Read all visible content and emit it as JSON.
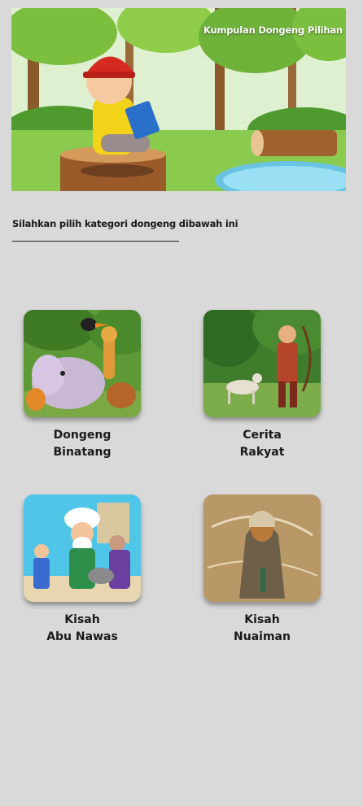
{
  "hero": {
    "title": "Kumpulan Dongeng Pilihan"
  },
  "prompt": {
    "text": "Silahkan pilih kategori dongeng dibawah ini"
  },
  "categories": [
    {
      "line1": "Dongeng",
      "line2": "Binatang"
    },
    {
      "line1": "Cerita",
      "line2": "Rakyat"
    },
    {
      "line1": "Kisah",
      "line2": "Abu Nawas"
    },
    {
      "line1": "Kisah",
      "line2": "Nuaiman"
    }
  ]
}
